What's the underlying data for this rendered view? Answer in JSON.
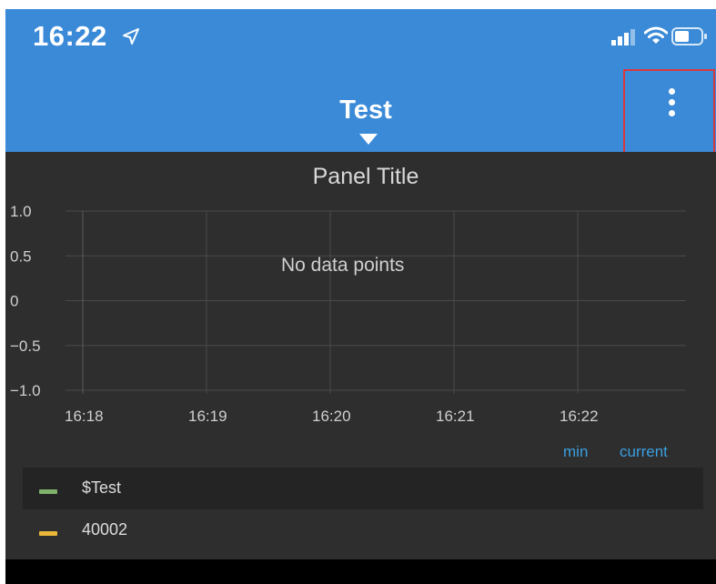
{
  "status_bar": {
    "time": "16:22",
    "icons": [
      "location-arrow-icon",
      "cellular-signal-icon",
      "wifi-icon",
      "battery-icon"
    ]
  },
  "header": {
    "title": "Test",
    "dropdown_icon": "caret-down-icon",
    "menu_icon": "vertical-ellipsis-icon"
  },
  "panel": {
    "title": "Panel Title",
    "no_data_text": "No data points"
  },
  "chart_data": {
    "type": "line",
    "title": "Panel Title",
    "x_ticks": [
      "16:18",
      "16:19",
      "16:20",
      "16:21",
      "16:22"
    ],
    "y_ticks": [
      "1.0",
      "0.5",
      "0",
      "−0.5",
      "−1.0"
    ],
    "ylim": [
      -1.0,
      1.0
    ],
    "grid": true,
    "series": [
      {
        "name": "$Test",
        "color": "#7eb26d",
        "values": []
      },
      {
        "name": "40002",
        "color": "#eab839",
        "values": []
      }
    ],
    "annotation": "No data points"
  },
  "legend": {
    "columns": [
      "min",
      "current"
    ],
    "items": [
      {
        "label": "$Test",
        "color": "#7eb26d"
      },
      {
        "label": "40002",
        "color": "#eab839"
      }
    ]
  },
  "colors": {
    "header_blue": "#3a8ad8",
    "panel_bg": "#2e2e2e",
    "legend_header": "#3a9fe0",
    "highlight_box": "#d9383e"
  }
}
